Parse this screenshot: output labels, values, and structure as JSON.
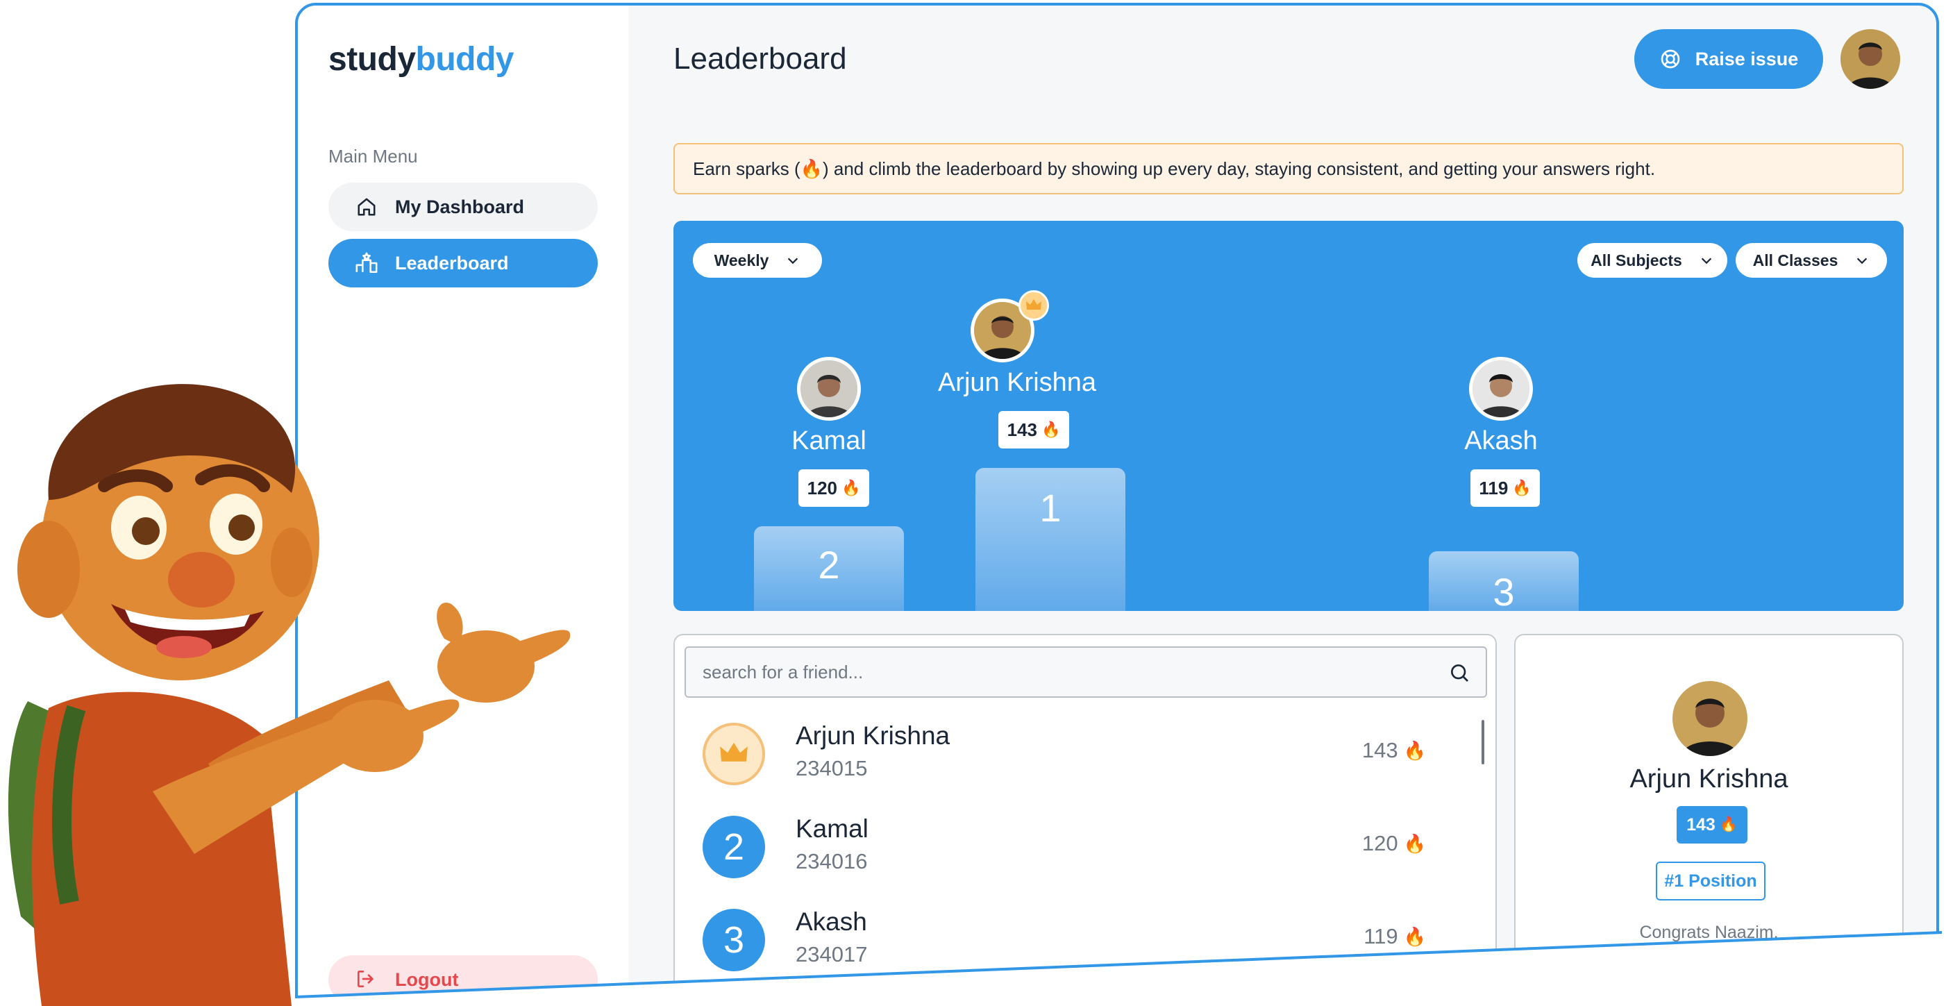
{
  "brand": {
    "part1": "study",
    "part2": "buddy",
    "accent": "#3197e6"
  },
  "sidebar": {
    "menu_title": "Main Menu",
    "items": [
      {
        "label": "My Dashboard",
        "icon": "home-icon",
        "active": false
      },
      {
        "label": "Leaderboard",
        "icon": "podium-icon",
        "active": true
      }
    ],
    "logout_label": "Logout"
  },
  "header": {
    "title": "Leaderboard",
    "raise_issue_label": "Raise issue"
  },
  "notice": {
    "text": "Earn sparks (🔥) and climb the leaderboard by showing up every day, staying consistent, and getting your answers right."
  },
  "filters": {
    "period": "Weekly",
    "subject": "All Subjects",
    "class": "All Classes"
  },
  "podium": {
    "first": {
      "name": "Arjun Krishna",
      "score": "143",
      "rank": "1"
    },
    "second": {
      "name": "Kamal",
      "score": "120",
      "rank": "2"
    },
    "third": {
      "name": "Akash",
      "score": "119",
      "rank": "3"
    }
  },
  "search": {
    "placeholder": "search for a friend..."
  },
  "list": [
    {
      "rank": "",
      "name": "Arjun Krishna",
      "id": "234015",
      "score": "143"
    },
    {
      "rank": "2",
      "name": "Kamal",
      "id": "234016",
      "score": "120"
    },
    {
      "rank": "3",
      "name": "Akash",
      "id": "234017",
      "score": "119"
    }
  ],
  "profile": {
    "name": "Arjun Krishna",
    "score": "143",
    "position": "#1 Position",
    "message": "Congrats Naazim,"
  },
  "spark_symbol": "🔥"
}
